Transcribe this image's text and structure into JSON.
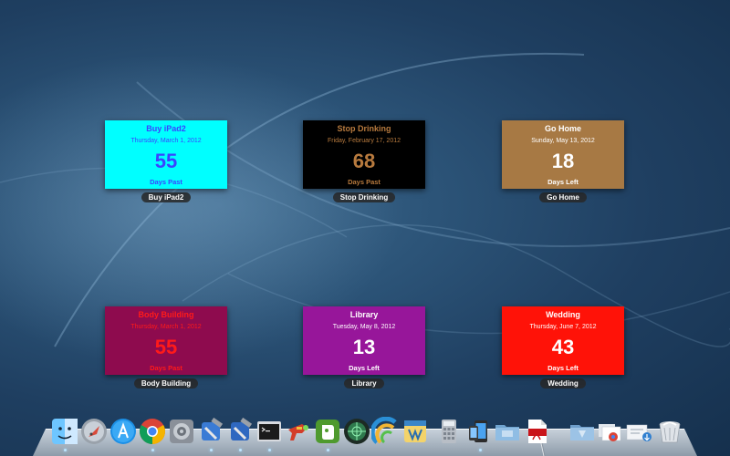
{
  "widgets": [
    {
      "id": "buy-ipad2",
      "title": "Buy iPad2",
      "date": "Thursday, March 1, 2012",
      "number": "55",
      "status": "Days Past",
      "caption": "Buy iPad2",
      "colors": {
        "bg": "#00ffff",
        "title": "#3b43ff",
        "text": "#3b43ff"
      }
    },
    {
      "id": "stop-drinking",
      "title": "Stop Drinking",
      "date": "Friday, February 17, 2012",
      "number": "68",
      "status": "Days Past",
      "caption": "Stop Drinking",
      "colors": {
        "bg": "#000000",
        "title": "#b77a3e",
        "text": "#b77a3e"
      }
    },
    {
      "id": "go-home",
      "title": "Go Home",
      "date": "Sunday, May 13, 2012",
      "number": "18",
      "status": "Days Left",
      "caption": "Go Home",
      "colors": {
        "bg": "#a77944",
        "title": "#ffffff",
        "text": "#ffffff"
      }
    },
    {
      "id": "body-building",
      "title": "Body Building",
      "date": "Thursday, March 1, 2012",
      "number": "55",
      "status": "Days Past",
      "caption": "Body Building",
      "colors": {
        "bg": "#8e0b4e",
        "title": "#ff1a1a",
        "text": "#ff1a1a"
      }
    },
    {
      "id": "library",
      "title": "Library",
      "date": "Tuesday, May 8, 2012",
      "number": "13",
      "status": "Days Left",
      "caption": "Library",
      "colors": {
        "bg": "#97169a",
        "title": "#ffffff",
        "text": "#ffffff"
      }
    },
    {
      "id": "wedding",
      "title": "Wedding",
      "date": "Thursday, June 7, 2012",
      "number": "43",
      "status": "Days Left",
      "caption": "Wedding",
      "colors": {
        "bg": "#ff1208",
        "title": "#ffffff",
        "text": "#ffffff"
      }
    }
  ],
  "dock": {
    "icons": [
      "finder-icon",
      "launchpad-icon",
      "app-store-icon",
      "chrome-icon",
      "system-preferences-icon",
      "xcode-icon",
      "xcode-icon",
      "terminal-icon",
      "ray-gun-icon",
      "evernote-icon",
      "instruments-icon",
      "istat-icon",
      "calendar-icon",
      "calculator-icon",
      "ios-simulator-icon",
      "folder-icon",
      "pdf-icon",
      "applications-folder-icon",
      "documents-stack-icon",
      "downloads-stack-icon",
      "trash-icon"
    ],
    "indicator_color": "#bfe6ff"
  }
}
